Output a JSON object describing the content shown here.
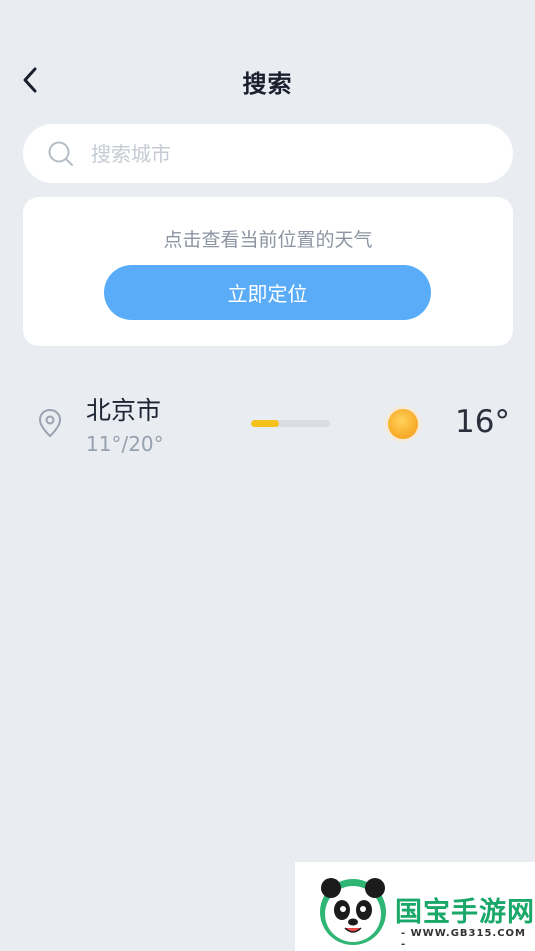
{
  "header": {
    "title": "搜索"
  },
  "search": {
    "placeholder": "搜索城市"
  },
  "locate_card": {
    "hint": "点击查看当前位置的天气",
    "button_label": "立即定位"
  },
  "cities": [
    {
      "name": "北京市",
      "range": "11°/20°",
      "temperature": "16°",
      "weather_icon": "sunny-icon",
      "temp_position_fraction": 0.35
    }
  ],
  "watermark": {
    "brand": "国宝手游网",
    "url": "- WWW.GB315.COM -"
  },
  "colors": {
    "accent": "#5aacf8",
    "background": "#e9edf2",
    "temp_bar_fill": "#f4c21b",
    "sun": "#f7a623"
  }
}
